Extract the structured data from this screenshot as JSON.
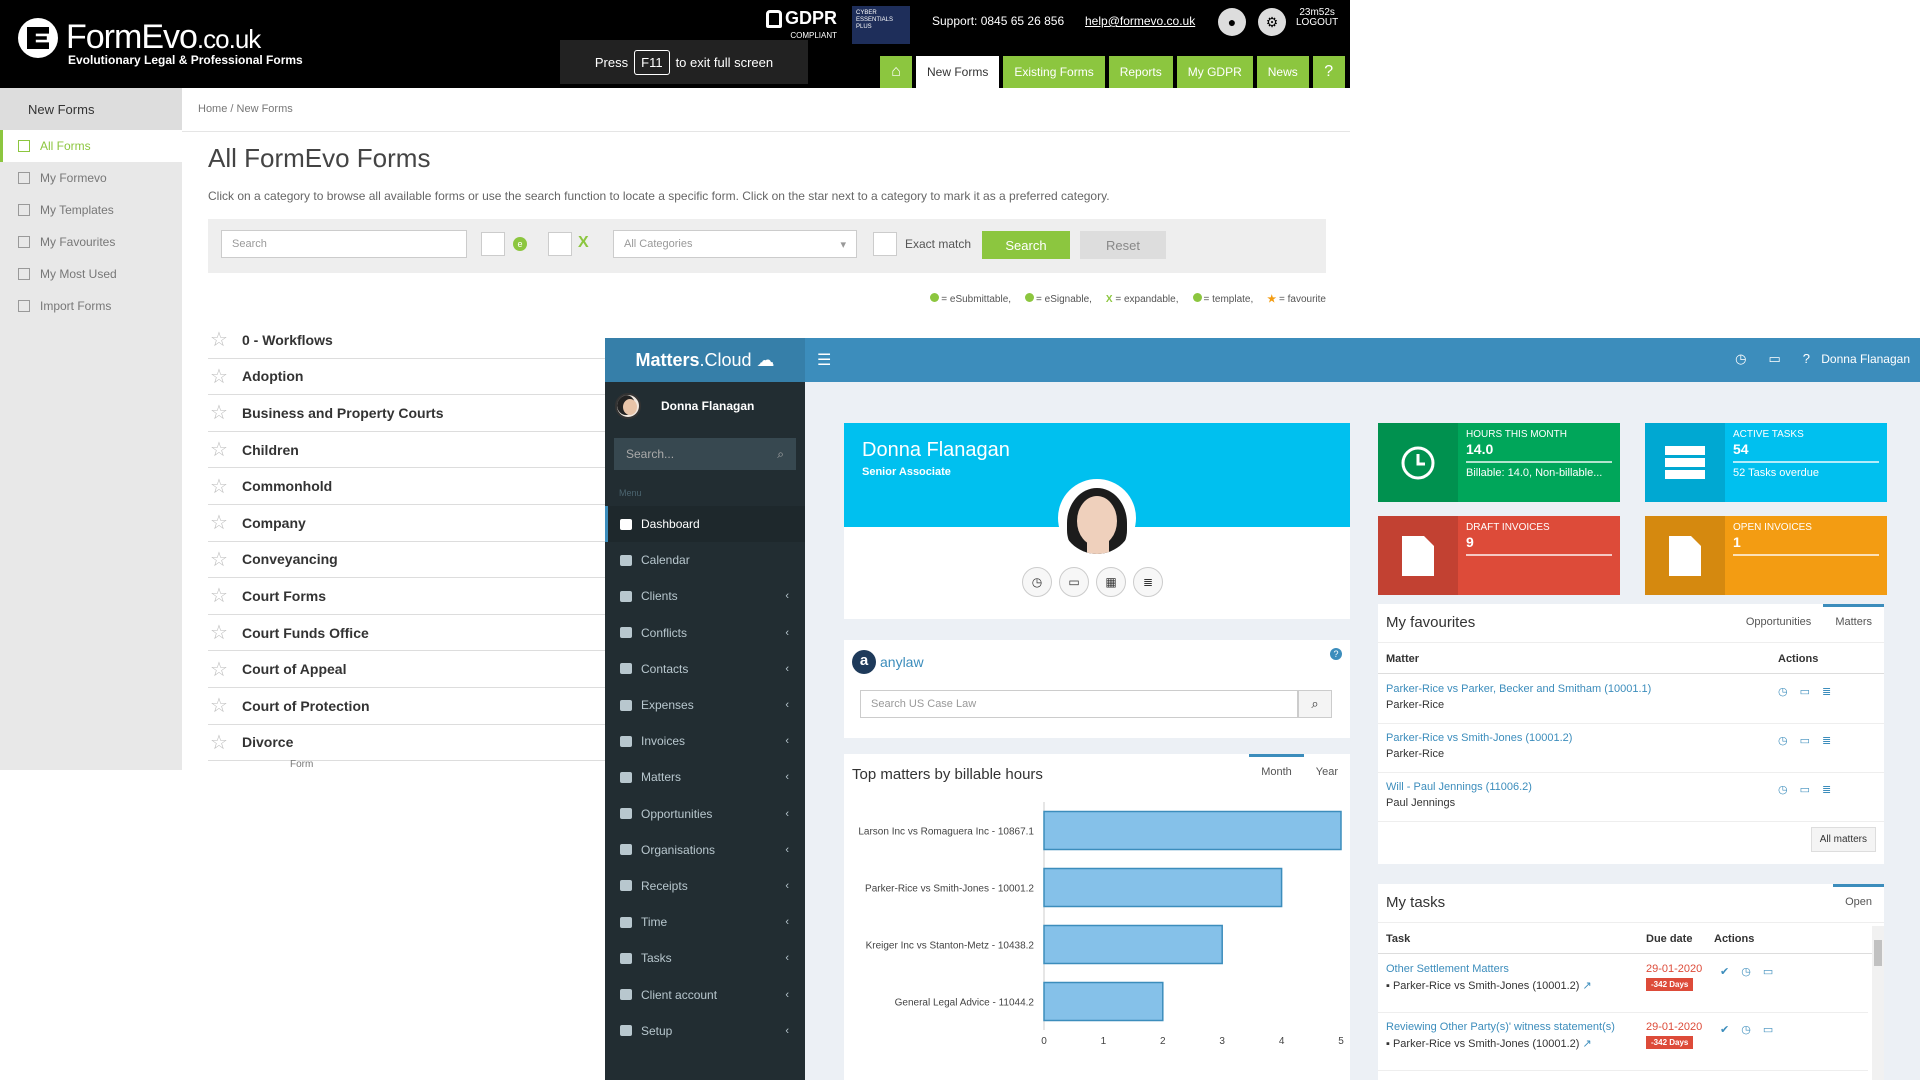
{
  "formevo": {
    "brand": "FormEvo",
    "brand_tld": ".co.uk",
    "tagline": "Evolutionary Legal & Professional Forms",
    "gdpr": "GDPR",
    "gdpr_sub": "COMPLIANT",
    "cyber_badge": "CYBER ESSENTIALS PLUS",
    "support": "Support: 0845 65 26 856",
    "email": "help@formevo.co.uk",
    "timer": "23m52s",
    "logout": "LOGOUT",
    "f11_press": "Press",
    "f11_key": "F11",
    "f11_text": "to exit full screen",
    "nav": [
      "New Forms",
      "Existing Forms",
      "Reports",
      "My GDPR",
      "News"
    ],
    "sidebar_head": "New Forms",
    "sidebar_items": [
      "All Forms",
      "My Formevo",
      "My Templates",
      "My Favourites",
      "My Most Used",
      "Import Forms"
    ],
    "breadcrumb": "Home / New Forms",
    "title": "All FormEvo Forms",
    "description": "Click on a category to browse all available forms or use the search function to locate a specific form. Click on the star next to a category to mark it as a preferred category.",
    "search_placeholder": "Search",
    "category_select": "All Categories",
    "exact_match": "Exact match",
    "search_btn": "Search",
    "reset_btn": "Reset",
    "legend": [
      "= eSubmittable,",
      "= eSignable,",
      "= expandable,",
      "= template,",
      "= favourite"
    ],
    "categories": [
      "0 - Workflows",
      "Adoption",
      "Business and Property Courts",
      "Children",
      "Commonhold",
      "Company",
      "Conveyancing",
      "Court Forms",
      "Court Funds Office",
      "Court of Appeal",
      "Court of Protection",
      "Divorce"
    ],
    "category_sub": "Form",
    "accent": "#8cc63f"
  },
  "matters": {
    "logo": "Matters",
    "logo_suffix": ".Cloud",
    "user": "Donna Flanagan",
    "search_placeholder": "Search...",
    "menu_label": "Menu",
    "menu": [
      "Dashboard",
      "Calendar",
      "Clients",
      "Conflicts",
      "Contacts",
      "Expenses",
      "Invoices",
      "Matters",
      "Opportunities",
      "Organisations",
      "Receipts",
      "Time",
      "Tasks",
      "Client account",
      "Setup"
    ],
    "profile": {
      "name": "Donna Flanagan",
      "role": "Senior Associate"
    },
    "anylaw": {
      "logo": "anylaw",
      "placeholder": "Search US Case Law"
    },
    "boxes": [
      {
        "label": "HOURS THIS MONTH",
        "value": "14.0",
        "sub": "Billable: 14.0, Non-billable...",
        "color": "#00a65a"
      },
      {
        "label": "ACTIVE TASKS",
        "value": "54",
        "sub": "52 Tasks overdue",
        "color": "#00c0ef"
      },
      {
        "label": "DRAFT INVOICES",
        "value": "9",
        "sub": "",
        "color": "#dd4b39"
      },
      {
        "label": "OPEN INVOICES",
        "value": "1",
        "sub": "",
        "color": "#f39c12"
      }
    ],
    "favourites": {
      "title": "My favourites",
      "tabs": [
        "Opportunities",
        "Matters"
      ],
      "col_matter": "Matter",
      "col_actions": "Actions",
      "rows": [
        {
          "matter": "Parker-Rice vs Parker, Becker and Smitham (10001.1)",
          "client": "Parker-Rice"
        },
        {
          "matter": "Parker-Rice vs Smith-Jones (10001.2)",
          "client": "Parker-Rice"
        },
        {
          "matter": "Will - Paul Jennings (11006.2)",
          "client": "Paul Jennings"
        }
      ],
      "all_button": "All matters"
    },
    "tasks": {
      "title": "My tasks",
      "tab": "Open",
      "col_task": "Task",
      "col_due": "Due date",
      "col_actions": "Actions",
      "rows": [
        {
          "task": "Other Settlement Matters",
          "matter": "Parker-Rice vs Smith-Jones (10001.2)",
          "due": "29-01-2020",
          "overdue": "-342 Days"
        },
        {
          "task": "Reviewing Other Party(s)' witness statement(s)",
          "matter": "Parker-Rice vs Smith-Jones (10001.2)",
          "due": "29-01-2020",
          "overdue": "-342 Days"
        }
      ]
    },
    "chart_tabs": [
      "Month",
      "Year"
    ]
  },
  "chart_data": {
    "type": "bar",
    "orientation": "horizontal",
    "title": "Top matters by billable hours",
    "categories": [
      "Larson Inc vs Romaguera Inc - 10867.1",
      "Parker-Rice vs Smith-Jones - 10001.2",
      "Kreiger Inc vs Stanton-Metz - 10438.2",
      "General Legal Advice - 11044.2"
    ],
    "values": [
      5,
      4,
      3,
      2
    ],
    "xlim": [
      0,
      5
    ],
    "xticks": [
      0,
      1,
      2,
      3,
      4,
      5
    ],
    "bar_color": "#85c1e9",
    "bar_border": "#3c8dbc"
  }
}
